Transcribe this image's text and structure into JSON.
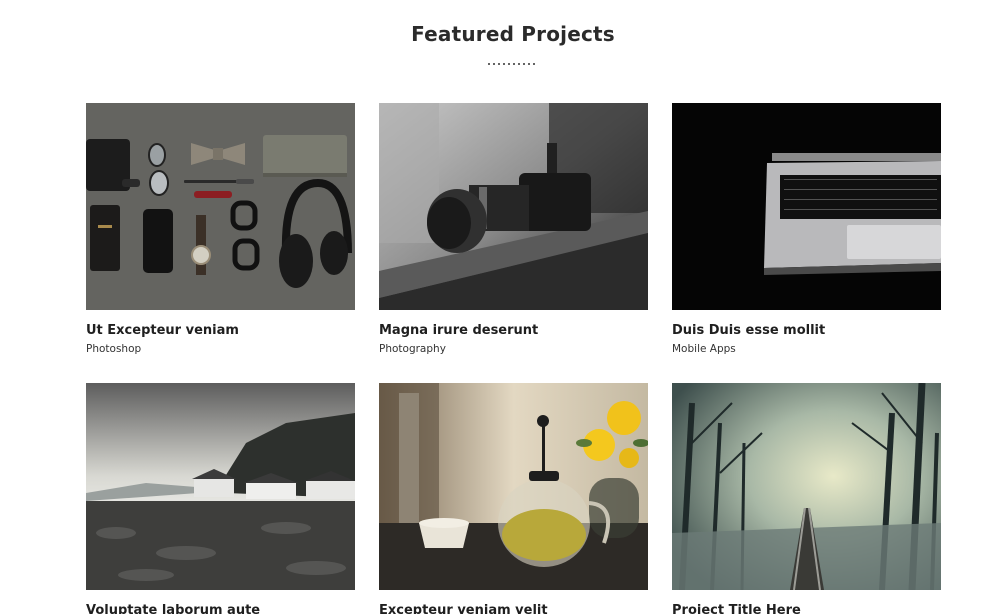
{
  "section": {
    "title": "Featured Projects"
  },
  "projects": [
    {
      "title": "Ut Excepteur veniam",
      "category": "Photoshop",
      "image": "flat-lay-accessories-photo"
    },
    {
      "title": "Magna irure deserunt",
      "category": "Photography",
      "image": "camera-photo"
    },
    {
      "title": "Duis Duis esse mollit",
      "category": "Mobile Apps",
      "image": "laptop-photo"
    },
    {
      "title": "Voluptate laborum aute",
      "category": "",
      "image": "coastal-village-photo"
    },
    {
      "title": "Excepteur veniam velit",
      "category": "",
      "image": "tea-pot-photo"
    },
    {
      "title": "Project Title Here",
      "category": "",
      "image": "forest-railway-photo"
    }
  ]
}
